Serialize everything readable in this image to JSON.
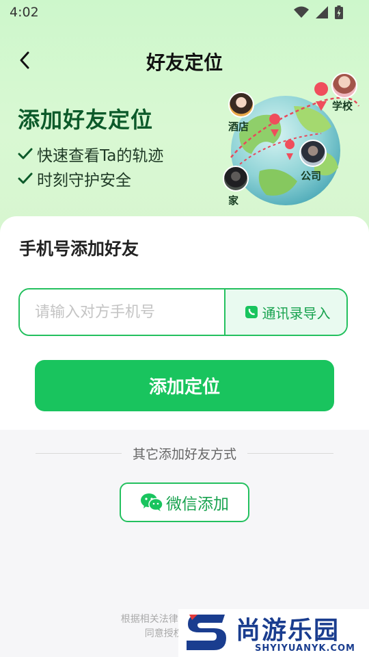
{
  "status_bar": {
    "time": "4:02",
    "icons": [
      "wifi-icon",
      "signal-icon",
      "battery-icon"
    ]
  },
  "header": {
    "title": "好友定位",
    "back_icon": "chevron-left-icon"
  },
  "banner": {
    "title": "添加好友定位",
    "features": [
      "快速查看Ta的轨迹",
      "时刻守护安全"
    ],
    "places": {
      "school": "学校",
      "hotel": "酒店",
      "company": "公司",
      "home": "家"
    }
  },
  "phone_section": {
    "title": "手机号添加好友",
    "input_placeholder": "请输入对方手机号",
    "input_value": "",
    "contacts_button": "通讯录导入",
    "submit_button": "添加定位"
  },
  "other_section": {
    "divider_text": "其它添加好友方式",
    "wechat_button": "微信添加"
  },
  "legal": {
    "line1": "根据相关法律和隐私政策规定,",
    "line2": "同意授权,不得在对"
  },
  "watermark": {
    "brand_cn": "尚游乐园",
    "brand_en": "SHYIYUANYK.COM"
  },
  "colors": {
    "accent": "#19c45e",
    "banner_bg": "#cdf7cb",
    "title_green": "#0c5a2a"
  }
}
